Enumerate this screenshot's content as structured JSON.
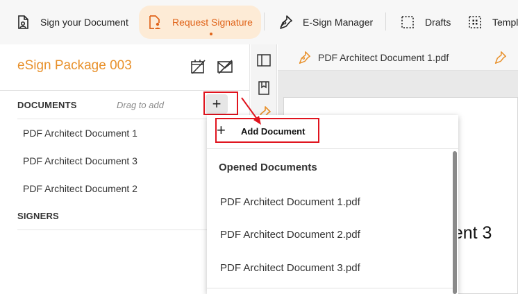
{
  "toolbar": {
    "items": [
      {
        "label": "Sign your Document",
        "icon": "sign-document-icon"
      },
      {
        "label": "Request Signature",
        "icon": "request-signature-icon",
        "active": true
      },
      {
        "label": "E-Sign Manager",
        "icon": "pen-nib-icon"
      },
      {
        "label": "Drafts",
        "icon": "dashed-square-icon"
      },
      {
        "label": "Templ",
        "icon": "template-icon"
      }
    ]
  },
  "package": {
    "title": "eSign Package 003",
    "icons": [
      "calendar-edit-icon",
      "envelope-off-icon"
    ]
  },
  "documents": {
    "header": "DOCUMENTS",
    "drag_hint": "Drag to add",
    "add_symbol": "+",
    "items": [
      "PDF Architect Document 1",
      "PDF Architect Document 3",
      "PDF Architect Document 2"
    ]
  },
  "signers": {
    "header": "SIGNERS"
  },
  "tabs": [
    {
      "label": "PDF Architect Document 1.pdf",
      "icon": "pen-nib-icon"
    },
    {
      "label": "",
      "icon": "pen-nib-icon"
    }
  ],
  "page_text": "ment 3",
  "dropdown": {
    "add_label": "Add Document",
    "add_symbol": "+",
    "heading": "Opened Documents",
    "items": [
      "PDF Architect Document 1.pdf",
      "PDF Architect Document 2.pdf",
      "PDF Architect Document 3.pdf"
    ]
  },
  "colors": {
    "accent": "#e0641a",
    "title_orange": "#e8912c",
    "highlight_red": "#e0141e",
    "active_bg": "#fdebd6"
  }
}
